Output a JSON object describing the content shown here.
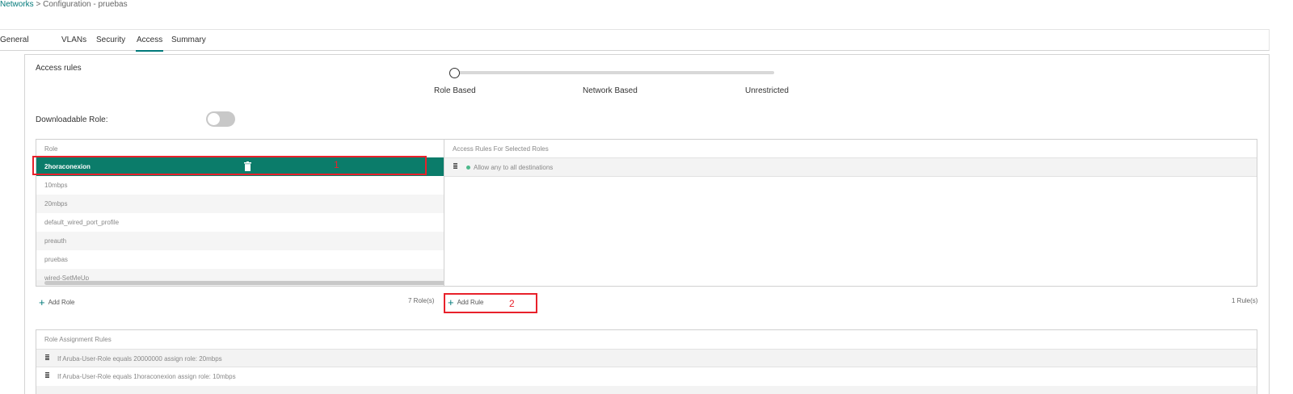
{
  "breadcrumb": {
    "link": "Networks",
    "separator": ">",
    "rest": "Configuration - pruebas"
  },
  "tabs": [
    "General",
    "VLANs",
    "Security",
    "Access",
    "Summary"
  ],
  "access_rules": {
    "title": "Access rules",
    "slider_labels": [
      "Role Based",
      "Network Based",
      "Unrestricted"
    ],
    "slider_selected": "Role Based"
  },
  "downloadable_role": {
    "label": "Downloadable Role:",
    "enabled": false
  },
  "roles": {
    "header": "Role",
    "items": [
      "2horaconexion",
      "10mbps",
      "20mbps",
      "default_wired_port_profile",
      "preauth",
      "pruebas",
      "wired-SetMeUp"
    ],
    "selected": "2horaconexion",
    "add_label": "Add Role",
    "count": "7 Role(s)"
  },
  "access_rules_selected": {
    "header": "Access Rules For Selected Roles",
    "items": [
      "Allow any to all destinations"
    ],
    "add_label": "Add Rule",
    "count": "1 Rule(s)"
  },
  "role_assignment": {
    "header": "Role Assignment Rules",
    "items": [
      "If Aruba-User-Role equals 20000000 assign role: 20mbps",
      "If Aruba-User-Role equals 1horaconexion assign role: 10mbps"
    ]
  },
  "annotations": [
    "1",
    "2"
  ],
  "colors": {
    "accent": "#00797a",
    "selected_row": "#0b7c6a",
    "annotation": "#e8212b",
    "rule_dot": "#4cb88a"
  }
}
